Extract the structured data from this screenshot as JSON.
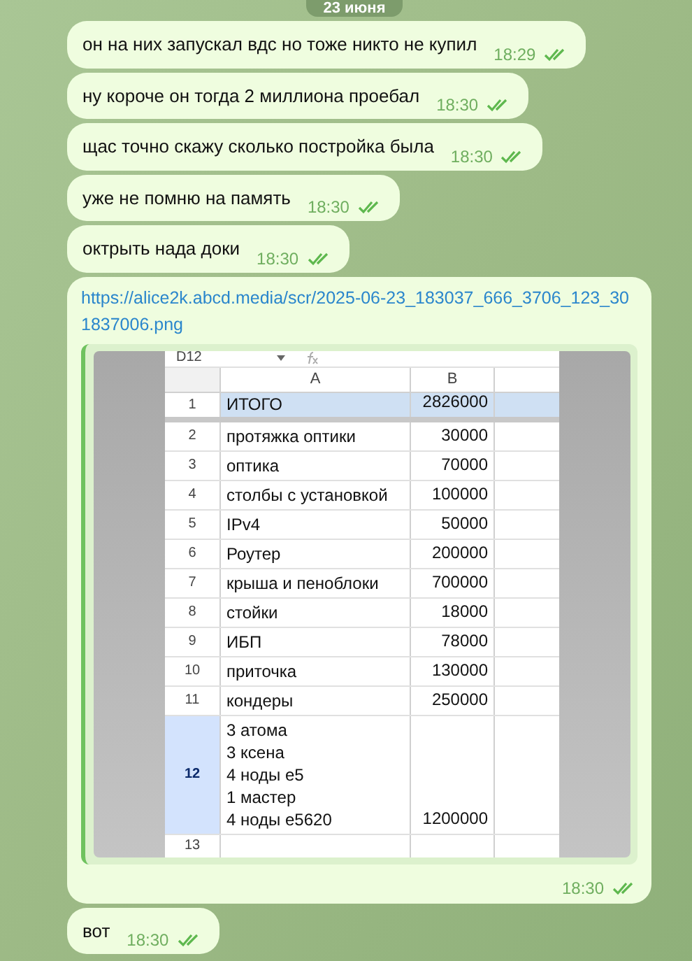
{
  "date_pill": "23 июня",
  "messages": [
    {
      "text": "он на них запускал вдс но тоже никто не купил",
      "time": "18:29",
      "read": true
    },
    {
      "text": "ну короче он тогда 2 миллиона проебал",
      "time": "18:30",
      "read": true
    },
    {
      "text": "щас точно скажу сколько постройка была",
      "time": "18:30",
      "read": true
    },
    {
      "text": "уже не помню на память",
      "time": "18:30",
      "read": true
    },
    {
      "text": "октрыть нада доки",
      "time": "18:30",
      "read": true
    }
  ],
  "link_message": {
    "url": "https://alice2k.abcd.media/scr/2025-06-23_183037_666_3706_123_301837006.png",
    "time": "18:30",
    "read": true,
    "sheet": {
      "name_box": "D12",
      "columns": [
        "A",
        "B"
      ],
      "rows": [
        {
          "number": "1",
          "lines": [
            "ИТОГО"
          ],
          "value": "2826000",
          "highlighted": true,
          "selected": false
        },
        {
          "number": "2",
          "lines": [
            "протяжка оптики"
          ],
          "value": "30000",
          "highlighted": false,
          "selected": false
        },
        {
          "number": "3",
          "lines": [
            "оптика"
          ],
          "value": "70000",
          "highlighted": false,
          "selected": false
        },
        {
          "number": "4",
          "lines": [
            "столбы с установкой"
          ],
          "value": "100000",
          "highlighted": false,
          "selected": false
        },
        {
          "number": "5",
          "lines": [
            "IPv4"
          ],
          "value": "50000",
          "highlighted": false,
          "selected": false
        },
        {
          "number": "6",
          "lines": [
            "Роутер"
          ],
          "value": "200000",
          "highlighted": false,
          "selected": false
        },
        {
          "number": "7",
          "lines": [
            "крыша и пеноблоки"
          ],
          "value": "700000",
          "highlighted": false,
          "selected": false
        },
        {
          "number": "8",
          "lines": [
            "стойки"
          ],
          "value": "18000",
          "highlighted": false,
          "selected": false
        },
        {
          "number": "9",
          "lines": [
            "ИБП"
          ],
          "value": "78000",
          "highlighted": false,
          "selected": false
        },
        {
          "number": "10",
          "lines": [
            "приточка"
          ],
          "value": "130000",
          "highlighted": false,
          "selected": false
        },
        {
          "number": "11",
          "lines": [
            "кондеры"
          ],
          "value": "250000",
          "highlighted": false,
          "selected": false
        },
        {
          "number": "12",
          "lines": [
            "3 атома",
            "3 ксена",
            "4 ноды е5",
            "1 мастер",
            "4 ноды е5620"
          ],
          "value": "1200000",
          "highlighted": false,
          "selected": true
        },
        {
          "number": "13",
          "lines": [],
          "value": "",
          "highlighted": false,
          "selected": false
        }
      ]
    }
  },
  "last_message": {
    "text": "вот",
    "time": "18:30",
    "read": true
  }
}
